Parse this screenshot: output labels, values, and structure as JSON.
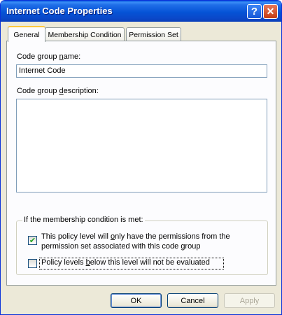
{
  "window": {
    "title": "Internet Code Properties",
    "help_glyph": "?",
    "close_glyph": "✕"
  },
  "tabs": [
    {
      "label": "General",
      "active": true
    },
    {
      "label": "Membership Condition",
      "active": false
    },
    {
      "label": "Permission Set",
      "active": false
    }
  ],
  "general": {
    "name_label_pre": "Code group ",
    "name_label_accel": "n",
    "name_label_post": "ame:",
    "name_value": "Internet Code",
    "desc_label_pre": "Code group ",
    "desc_label_accel": "d",
    "desc_label_post": "escription:",
    "desc_value": "",
    "group_title": "If the membership condition is met:",
    "check1": {
      "checked": true,
      "line1_pre": "This policy level will ",
      "line1_accel": "o",
      "line1_post": "nly have the permissions from the",
      "line2": "permission set associated with this code group"
    },
    "check2": {
      "checked": false,
      "pre": "Policy levels ",
      "accel": "b",
      "post": "elow this level will not be evaluated"
    },
    "check_glyph": "✔"
  },
  "buttons": {
    "ok": "OK",
    "cancel": "Cancel",
    "apply": "Apply"
  },
  "colors": {
    "titlebar": "#0553d6",
    "face": "#ece9d8",
    "panel": "#fcfcfe",
    "active_tab_accent": "#ffc83c"
  }
}
